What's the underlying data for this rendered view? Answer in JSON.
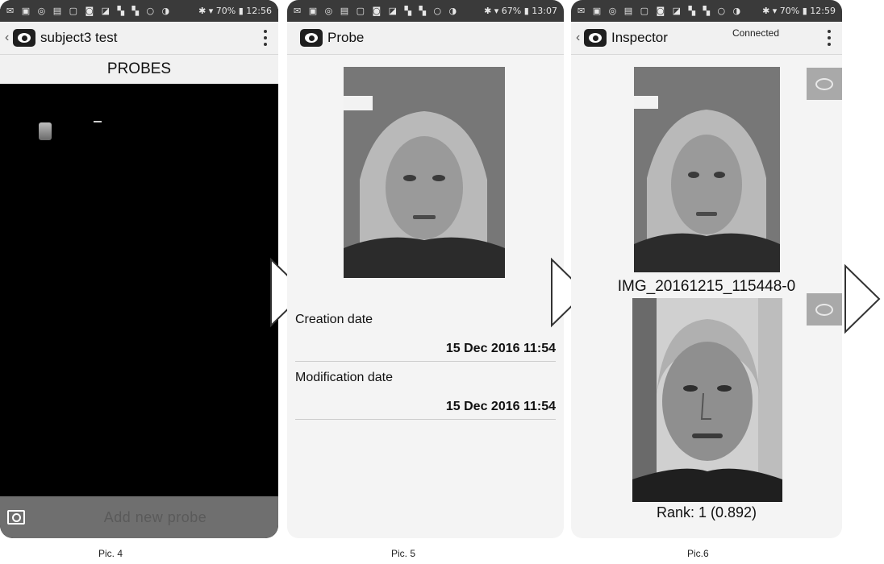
{
  "screens": {
    "pic4": {
      "status": {
        "icons": "✉ ▣ ◎ ▤ ▢ ◙ ◪ ▚ ▚ ○ ◑",
        "right": "✱ ▾ 70% ▮ 12:56"
      },
      "title": "subject3 test",
      "section_title": "PROBES",
      "add_button": "Add new probe",
      "caption": "Pic. 4"
    },
    "pic5": {
      "status": {
        "icons": "✉ ▣ ◎ ▤ ▢ ◙ ◪ ▚ ▚ ○ ◑",
        "right": "✱ ▾ 67% ▮ 13:07"
      },
      "title": "Probe",
      "fields": [
        {
          "label": "Creation date",
          "value": "15 Dec 2016 11:54"
        },
        {
          "label": "Modification date",
          "value": "15 Dec 2016 11:54"
        }
      ],
      "caption": "Pic. 5"
    },
    "pic6": {
      "status": {
        "icons": "✉ ▣ ◎ ▤ ▢ ◙ ◪ ▚ ▚ ○ ◑",
        "right": "✱ ▾ 70% ▮ 12:59"
      },
      "title": "Inspector",
      "connection_status": "Connected",
      "image_name": "IMG_20161215_115448-0",
      "rank": "Rank: 1 (0.892)",
      "caption": "Pic.6"
    }
  },
  "colors": {
    "status_bar": "#3a3a3a",
    "action_bar": "#f1f1f1",
    "bottom_bar": "#6f6f6f",
    "side_button": "#a9a9a9"
  }
}
